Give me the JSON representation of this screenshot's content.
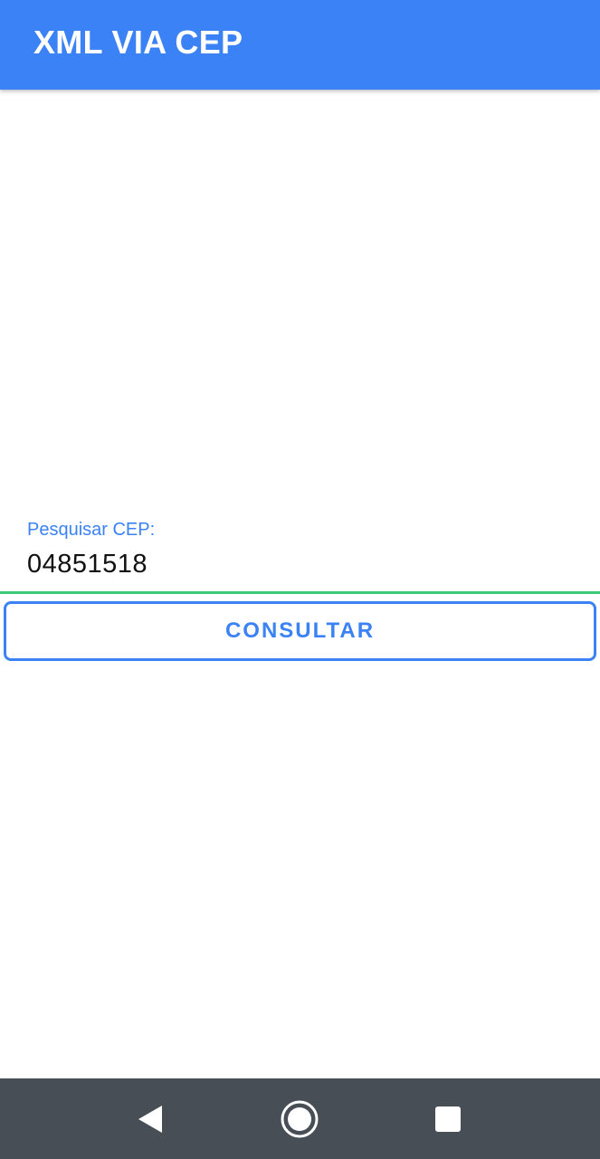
{
  "app_bar": {
    "title": "XML VIA CEP",
    "color": "#3b82f6"
  },
  "search": {
    "label": "Pesquisar CEP:",
    "value": "04851518",
    "underline_color": "#3ec97a"
  },
  "consult_button": {
    "label": "CONSULTAR"
  },
  "nav_bar": {
    "back_icon": "back-triangle-icon",
    "home_icon": "home-circle-icon",
    "recents_icon": "recents-square-icon",
    "color": "#474e55"
  }
}
